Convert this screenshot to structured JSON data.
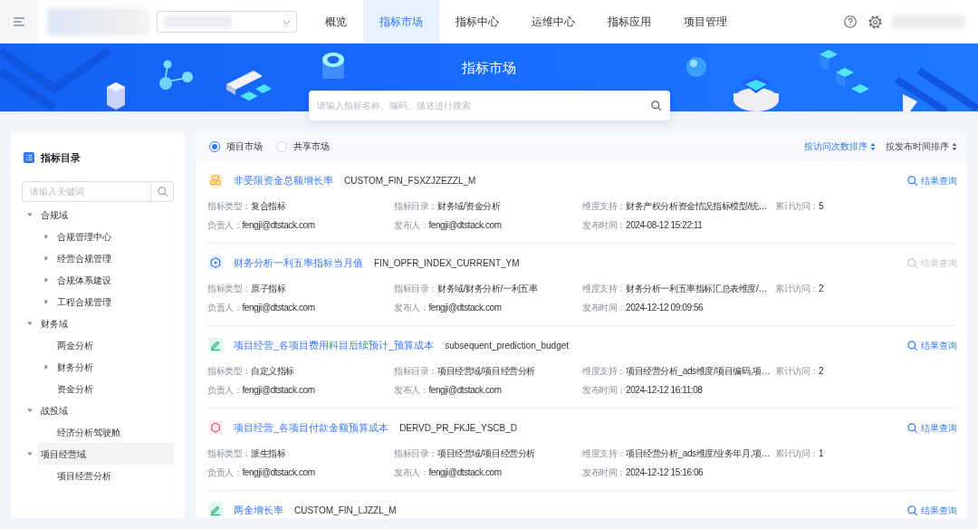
{
  "topbar": {
    "nav": [
      {
        "label": "概览",
        "selected": false
      },
      {
        "label": "指标市场",
        "selected": true
      },
      {
        "label": "指标中心",
        "selected": false
      },
      {
        "label": "运维中心",
        "selected": false
      },
      {
        "label": "指标应用",
        "selected": false
      },
      {
        "label": "项目管理",
        "selected": false
      }
    ]
  },
  "banner": {
    "title": "指标市场",
    "search": {
      "placeholder": "请输入指标名称、编码、描述进行搜索"
    }
  },
  "catalog": {
    "title": "指标目录",
    "search": {
      "placeholder": "请输入关键词"
    },
    "items": [
      {
        "label": "合规域",
        "kind": "branch",
        "expanded": true,
        "selected": false,
        "children": [
          {
            "label": "合规管理中心",
            "kind": "branch",
            "expanded": false,
            "selected": false
          },
          {
            "label": "经营合规管理",
            "kind": "branch",
            "expanded": false,
            "selected": false
          },
          {
            "label": "合规体系建设",
            "kind": "branch",
            "expanded": false,
            "selected": false
          },
          {
            "label": "工程合规管理",
            "kind": "branch",
            "expanded": false,
            "selected": false
          }
        ]
      },
      {
        "label": "财务域",
        "kind": "branch",
        "expanded": true,
        "selected": false,
        "children": [
          {
            "label": "两金分析",
            "kind": "leaf",
            "selected": false
          },
          {
            "label": "财务分析",
            "kind": "branch",
            "expanded": false,
            "selected": false
          },
          {
            "label": "资金分析",
            "kind": "leaf",
            "selected": false
          }
        ]
      },
      {
        "label": "战投域",
        "kind": "branch",
        "expanded": true,
        "selected": false,
        "children": [
          {
            "label": "经济分析驾驶舱",
            "kind": "leaf",
            "selected": false
          }
        ]
      },
      {
        "label": "项目经营域",
        "kind": "branch",
        "expanded": true,
        "selected": true,
        "children": [
          {
            "label": "项目经营分析",
            "kind": "leaf",
            "selected": false
          }
        ]
      }
    ]
  },
  "market": {
    "scopes": [
      {
        "label": "项目市场",
        "selected": true
      },
      {
        "label": "共享市场",
        "selected": false
      }
    ],
    "sorts": [
      {
        "label": "按访问次数排序",
        "selected": true
      },
      {
        "label": "按发布时间排序",
        "selected": false
      }
    ],
    "cards": [
      {
        "kind": "composite",
        "title": "非受限资金总额增长率",
        "code": "CUSTOM_FIN_FSXZJZEZZL_M",
        "action": {
          "label": "结果查询",
          "disabled": false
        },
        "fields": [
          {
            "label": "指标类型：",
            "value": "复合指标"
          },
          {
            "label": "指标目录：",
            "value": "财务域/资金分析"
          },
          {
            "label": "维度支持：",
            "value": "财务产权分析资金情况指标模型/统…"
          },
          {
            "label": "累计访问：",
            "value": "5"
          },
          {
            "label": "负责人：",
            "value": "fengji@dtstack.com"
          },
          {
            "label": "发布人：",
            "value": "fengji@dtstack.com"
          },
          {
            "label": "发布时间：",
            "value": "2024-08-12 15:22:11"
          }
        ]
      },
      {
        "kind": "atomic",
        "title": "财务分析一利五率指标当月值",
        "code": "FIN_OPFR_INDEX_CURRENT_YM",
        "action": {
          "label": "结果查询",
          "disabled": true
        },
        "fields": [
          {
            "label": "指标类型：",
            "value": "原子指标"
          },
          {
            "label": "指标目录：",
            "value": "财务域/财务分析/一利五率"
          },
          {
            "label": "维度支持：",
            "value": "财务分析一利五率指标汇总表维度/…"
          },
          {
            "label": "累计访问：",
            "value": "2"
          },
          {
            "label": "负责人：",
            "value": "fengji@dtstack.com"
          },
          {
            "label": "发布人：",
            "value": "fengji@dtstack.com"
          },
          {
            "label": "发布时间：",
            "value": "2024-12-12 09:09:56"
          }
        ]
      },
      {
        "kind": "custom",
        "title": "项目经营_各项目费用科目后续预计_预算成本",
        "code": "subsequent_prediction_budget",
        "action": {
          "label": "结果查询",
          "disabled": false
        },
        "fields": [
          {
            "label": "指标类型：",
            "value": "自定义指标"
          },
          {
            "label": "指标目录：",
            "value": "项目经营域/项目经营分析"
          },
          {
            "label": "维度支持：",
            "value": "项目经营分析_ads维度/项目编码,项…"
          },
          {
            "label": "累计访问：",
            "value": "2"
          },
          {
            "label": "负责人：",
            "value": "fengji@dtstack.com"
          },
          {
            "label": "发布人：",
            "value": "fengji@dtstack.com"
          },
          {
            "label": "发布时间：",
            "value": "2024-12-12 16:11:08"
          }
        ]
      },
      {
        "kind": "derived",
        "title": "项目经营_各项目付款金额预算成本",
        "code": "DERVD_PR_FKJE_YSCB_D",
        "action": {
          "label": "结果查询",
          "disabled": false
        },
        "fields": [
          {
            "label": "指标类型：",
            "value": "派生指标"
          },
          {
            "label": "指标目录：",
            "value": "项目经营域/项目经营分析"
          },
          {
            "label": "维度支持：",
            "value": "项目经营分析_ads维度/业务年月,项…"
          },
          {
            "label": "累计访问：",
            "value": "1"
          },
          {
            "label": "负责人：",
            "value": "fengji@dtstack.com"
          },
          {
            "label": "发布人：",
            "value": "fengji@dtstack.com"
          },
          {
            "label": "发布时间：",
            "value": "2024-12-12 15:16:06"
          }
        ]
      },
      {
        "kind": "custom",
        "title": "两金增长率",
        "code": "CUSTOM_FIN_LJZZL_M",
        "action": {
          "label": "结果查询",
          "disabled": false
        }
      }
    ]
  }
}
